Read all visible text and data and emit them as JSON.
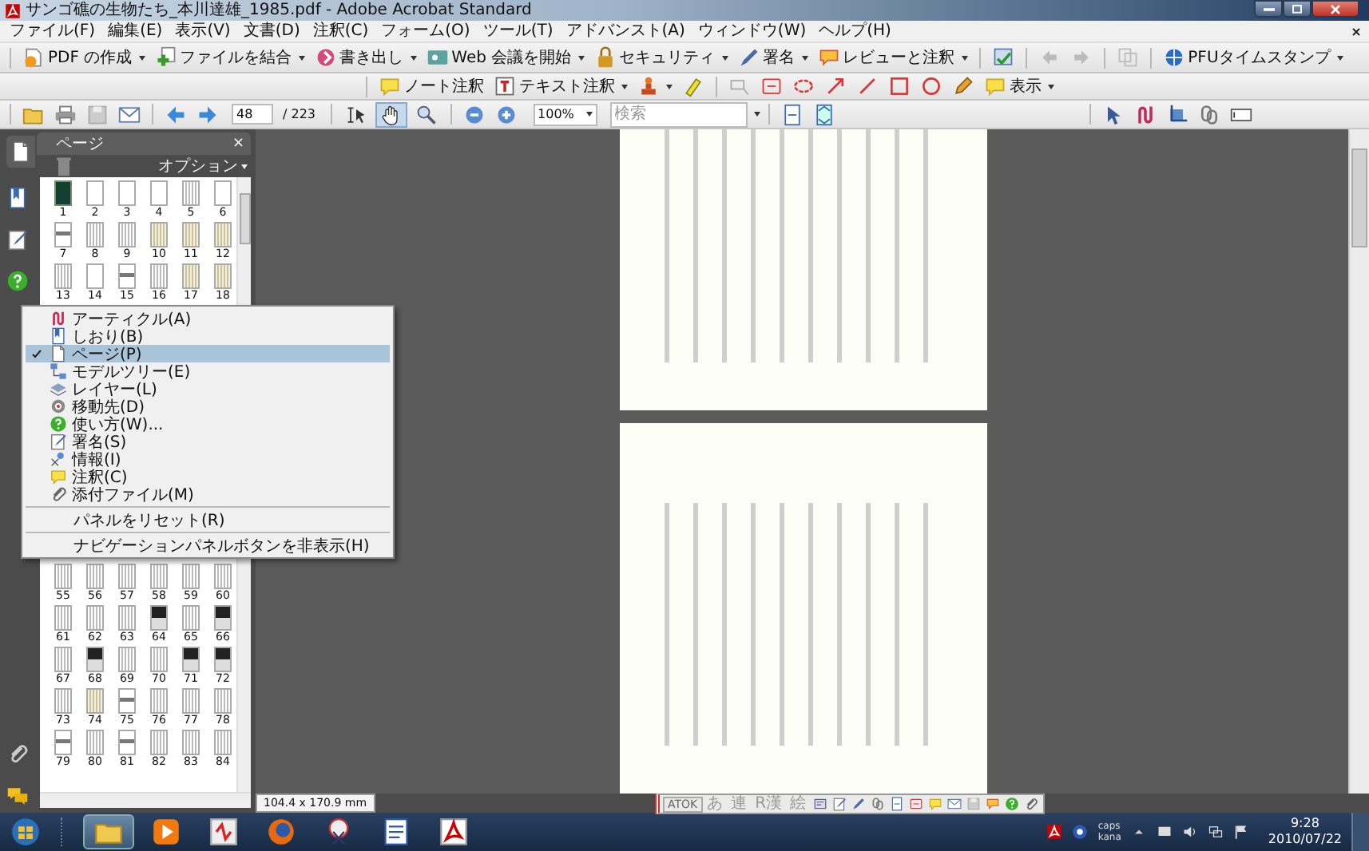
{
  "window": {
    "title": "サンゴ礁の生物たち_本川達雄_1985.pdf - Adobe Acrobat Standard"
  },
  "menu_bar": [
    "ファイル(F)",
    "編集(E)",
    "表示(V)",
    "文書(D)",
    "注釈(C)",
    "フォーム(O)",
    "ツール(T)",
    "アドバンスト(A)",
    "ウィンドウ(W)",
    "ヘルプ(H)"
  ],
  "task_toolbar": [
    "PDF の作成",
    "ファイルを結合",
    "書き出し",
    "Web 会議を開始",
    "セキュリティ",
    "署名",
    "レビューと注釈",
    "PFUタイムスタンプ"
  ],
  "comment_toolbar": [
    "ノート注釈",
    "テキスト注釈",
    "表示"
  ],
  "navigation_toolbar": {
    "page": "48",
    "page_count": "/ 223",
    "zoom": "100%",
    "search": {
      "placeholder": "検索"
    },
    "tools": [
      {
        "selected": false
      },
      {
        "selected": true
      },
      {
        "selected": false
      }
    ]
  },
  "nav_panel": {
    "title": "ページ",
    "close": "×",
    "options": "オプション",
    "thumbnails": [
      {
        "label": "1",
        "kind": "cover"
      },
      {
        "label": "2",
        "kind": "blank"
      },
      {
        "label": "3",
        "kind": "blank"
      },
      {
        "label": "4",
        "kind": "blank"
      },
      {
        "label": "5",
        "kind": "text"
      },
      {
        "label": "6",
        "kind": "blank"
      },
      {
        "label": "7",
        "kind": "figure"
      },
      {
        "label": "8",
        "kind": "text"
      },
      {
        "label": "9",
        "kind": "text"
      },
      {
        "label": "10",
        "kind": "tinted"
      },
      {
        "label": "11",
        "kind": "tinted"
      },
      {
        "label": "12",
        "kind": "tinted"
      },
      {
        "label": "13",
        "kind": "text"
      },
      {
        "label": "14",
        "kind": "blank"
      },
      {
        "label": "15",
        "kind": "figure"
      },
      {
        "label": "16",
        "kind": "text"
      },
      {
        "label": "17",
        "kind": "tinted"
      },
      {
        "label": "18",
        "kind": "tinted"
      }
    ],
    "thumbnails_lower": [
      {
        "label": "55",
        "kind": "text"
      },
      {
        "label": "56",
        "kind": "text"
      },
      {
        "label": "57",
        "kind": "text"
      },
      {
        "label": "58",
        "kind": "text"
      },
      {
        "label": "59",
        "kind": "text"
      },
      {
        "label": "60",
        "kind": "text"
      },
      {
        "label": "61",
        "kind": "text"
      },
      {
        "label": "62",
        "kind": "text"
      },
      {
        "label": "63",
        "kind": "text"
      },
      {
        "label": "64",
        "kind": "photo"
      },
      {
        "label": "65",
        "kind": "text"
      },
      {
        "label": "66",
        "kind": "photo"
      },
      {
        "label": "67",
        "kind": "text"
      },
      {
        "label": "68",
        "kind": "photo"
      },
      {
        "label": "69",
        "kind": "text"
      },
      {
        "label": "70",
        "kind": "text"
      },
      {
        "label": "71",
        "kind": "photo"
      },
      {
        "label": "72",
        "kind": "photo"
      },
      {
        "label": "73",
        "kind": "text"
      },
      {
        "label": "74",
        "kind": "tinted"
      },
      {
        "label": "75",
        "kind": "figure"
      },
      {
        "label": "76",
        "kind": "text"
      },
      {
        "label": "77",
        "kind": "text"
      },
      {
        "label": "78",
        "kind": "text"
      },
      {
        "label": "79",
        "kind": "figure"
      },
      {
        "label": "80",
        "kind": "text"
      },
      {
        "label": "81",
        "kind": "figure"
      },
      {
        "label": "82",
        "kind": "text"
      },
      {
        "label": "83",
        "kind": "text"
      },
      {
        "label": "84",
        "kind": "text"
      }
    ]
  },
  "context_menu": {
    "items": [
      {
        "label": "アーティクル(A)",
        "checked": false,
        "selected": false
      },
      {
        "label": "しおり(B)",
        "checked": false,
        "selected": false
      },
      {
        "label": "ページ(P)",
        "checked": true,
        "selected": true
      },
      {
        "label": "モデルツリー(E)",
        "checked": false,
        "selected": false
      },
      {
        "label": "レイヤー(L)",
        "checked": false,
        "selected": false
      },
      {
        "label": "移動先(D)",
        "checked": false,
        "selected": false
      },
      {
        "label": "使い方(W)...",
        "checked": false,
        "selected": false
      },
      {
        "label": "署名(S)",
        "checked": false,
        "selected": false
      },
      {
        "label": "情報(I)",
        "checked": false,
        "selected": false
      },
      {
        "label": "注釈(C)",
        "checked": false,
        "selected": false
      },
      {
        "label": "添付ファイル(M)",
        "checked": false,
        "selected": false
      }
    ],
    "actions": [
      "パネルをリセット(R)",
      "ナビゲーションパネルボタンを非表示(H)"
    ]
  },
  "status_bar": {
    "page_size": "104.4 x 170.9 mm"
  },
  "ime_bar": {
    "labels": [
      "ATOK",
      "あ",
      "連",
      "R漢",
      "絵"
    ]
  },
  "taskbar": {
    "items": [
      {
        "selected": true
      },
      {
        "selected": false
      },
      {
        "selected": false
      },
      {
        "selected": false
      },
      {
        "selected": false
      },
      {
        "selected": false
      },
      {
        "selected": false
      }
    ],
    "tray": {
      "caps": "caps",
      "kana": "kana",
      "time": "9:28",
      "date": "2010/07/22"
    }
  }
}
